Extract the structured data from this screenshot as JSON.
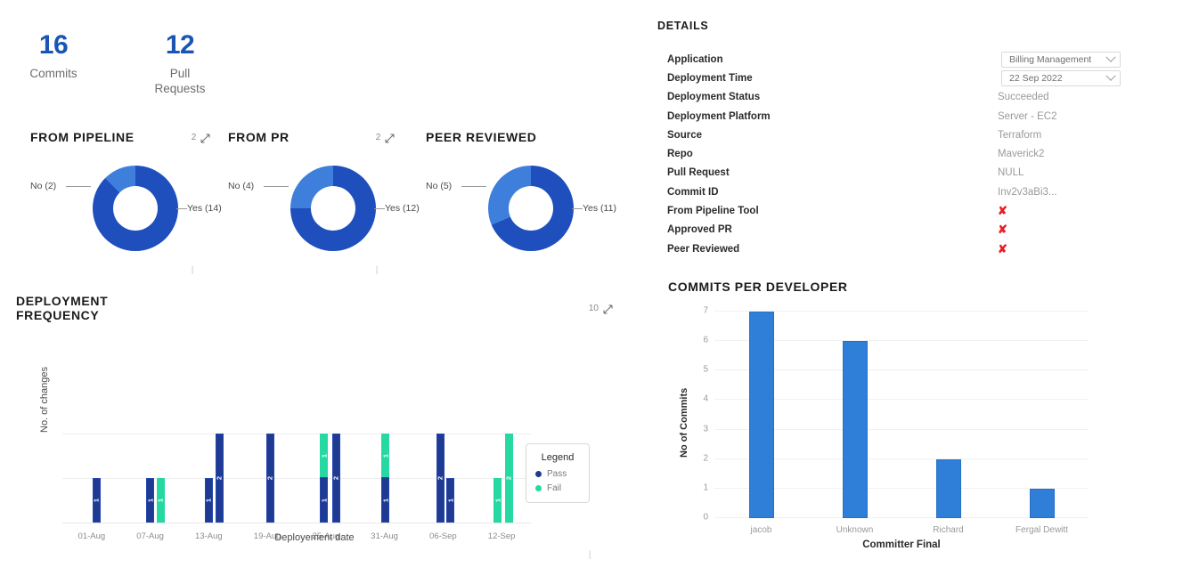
{
  "kpis": [
    {
      "value": "16",
      "label": "Commits"
    },
    {
      "value": "12",
      "label": "Pull\nRequests"
    }
  ],
  "donuts": [
    {
      "title": "FROM PIPELINE",
      "count": "2",
      "expand_icon": "expand-icon",
      "no_label": "No (2)",
      "yes_label": "Yes (14)",
      "yes_value": 14,
      "no_value": 2
    },
    {
      "title": "FROM PR",
      "count": "2",
      "expand_icon": "expand-icon",
      "no_label": "No (4)",
      "yes_label": "Yes (12)",
      "yes_value": 12,
      "no_value": 4
    },
    {
      "title": "PEER REVIEWED",
      "count": "",
      "expand_icon": "",
      "no_label": "No (5)",
      "yes_label": "Yes (11)",
      "yes_value": 11,
      "no_value": 5
    }
  ],
  "colors": {
    "brand_blue": "#1956b3",
    "donut_yes": "#1e4fbd",
    "donut_no": "#3f7fdc",
    "pass": "#1f3a93",
    "fail": "#26d9a3",
    "commits_bar": "#2f7ed8",
    "cross_red": "#ed1c24"
  },
  "deployment_frequency": {
    "title": "DEPLOYMENT FREQUENCY",
    "count": "10",
    "expand_icon": "expand-icon",
    "legend_title": "Legend",
    "legend": [
      {
        "label": "Pass",
        "color": "#1f3a93"
      },
      {
        "label": "Fail",
        "color": "#26d9a3"
      }
    ]
  },
  "details": {
    "title": "DETAILS",
    "rows": [
      {
        "label": "Application",
        "value": "Billing Management",
        "type": "select"
      },
      {
        "label": "Deployment Time",
        "value": "22 Sep 2022",
        "type": "select"
      },
      {
        "label": "Deployment Status",
        "value": "Succeeded",
        "type": "text"
      },
      {
        "label": "Deployment Platform",
        "value": "Server - EC2",
        "type": "text"
      },
      {
        "label": "Source",
        "value": "Terraform",
        "type": "text"
      },
      {
        "label": "Repo",
        "value": "Maverick2",
        "type": "text"
      },
      {
        "label": "Pull Request",
        "value": "NULL",
        "type": "text"
      },
      {
        "label": "Commit ID",
        "value": "Inv2v3aBi3...",
        "type": "text"
      },
      {
        "label": "From Pipeline Tool",
        "value": "✘",
        "type": "cross"
      },
      {
        "label": "Approved PR",
        "value": "✘",
        "type": "cross"
      },
      {
        "label": "Peer Reviewed",
        "value": "✘",
        "type": "cross"
      }
    ]
  },
  "commits_per_developer": {
    "title": "COMMITS PER DEVELOPER"
  },
  "chart_data": [
    {
      "type": "bar",
      "name": "deployment-frequency",
      "title": "DEPLOYMENT FREQUENCY",
      "xlabel": "Deployement date",
      "ylabel": "No. of changes",
      "ylim": [
        0,
        3
      ],
      "yticks": [
        0,
        1,
        2
      ],
      "grid": true,
      "stacked": true,
      "legend": [
        "Pass",
        "Fail"
      ],
      "legend_position": "right",
      "xticks": [
        "01-Aug",
        "07-Aug",
        "13-Aug",
        "19-Aug",
        "25-Aug",
        "31-Aug",
        "06-Sep",
        "12-Sep"
      ],
      "bars": [
        {
          "x": 0.08,
          "pass": 1,
          "fail": 0
        },
        {
          "x": 1.0,
          "pass": 1,
          "fail": 0
        },
        {
          "x": 1.18,
          "pass": 0,
          "fail": 1
        },
        {
          "x": 2.0,
          "pass": 1,
          "fail": 0
        },
        {
          "x": 2.18,
          "pass": 2,
          "fail": 0
        },
        {
          "x": 3.05,
          "pass": 2,
          "fail": 0
        },
        {
          "x": 3.97,
          "pass": 1,
          "fail": 1
        },
        {
          "x": 4.17,
          "pass": 2,
          "fail": 0
        },
        {
          "x": 5.02,
          "pass": 1,
          "fail": 1
        },
        {
          "x": 5.95,
          "pass": 2,
          "fail": 0
        },
        {
          "x": 6.13,
          "pass": 1,
          "fail": 0
        },
        {
          "x": 6.93,
          "pass": 0,
          "fail": 1
        },
        {
          "x": 7.12,
          "pass": 0,
          "fail": 2
        }
      ]
    },
    {
      "type": "bar",
      "name": "commits-per-developer",
      "title": "COMMITS PER DEVELOPER",
      "xlabel": "Committer Final",
      "ylabel": "No of Commits",
      "categories": [
        "jacob",
        "Unknown",
        "Richard",
        "Fergal Dewitt"
      ],
      "values": [
        7,
        6,
        2,
        1
      ],
      "ylim": [
        0,
        7
      ],
      "yticks": [
        0,
        1,
        2,
        3,
        4,
        5,
        6,
        7
      ],
      "grid": true,
      "color": "#2f7ed8"
    },
    {
      "type": "pie",
      "name": "from-pipeline",
      "title": "FROM PIPELINE",
      "labels": [
        "Yes (14)",
        "No (2)"
      ],
      "values": [
        14,
        2
      ]
    },
    {
      "type": "pie",
      "name": "from-pr",
      "title": "FROM PR",
      "labels": [
        "Yes (12)",
        "No (4)"
      ],
      "values": [
        12,
        4
      ]
    },
    {
      "type": "pie",
      "name": "peer-reviewed",
      "title": "PEER REVIEWED",
      "labels": [
        "Yes (11)",
        "No (5)"
      ],
      "values": [
        11,
        5
      ]
    }
  ]
}
